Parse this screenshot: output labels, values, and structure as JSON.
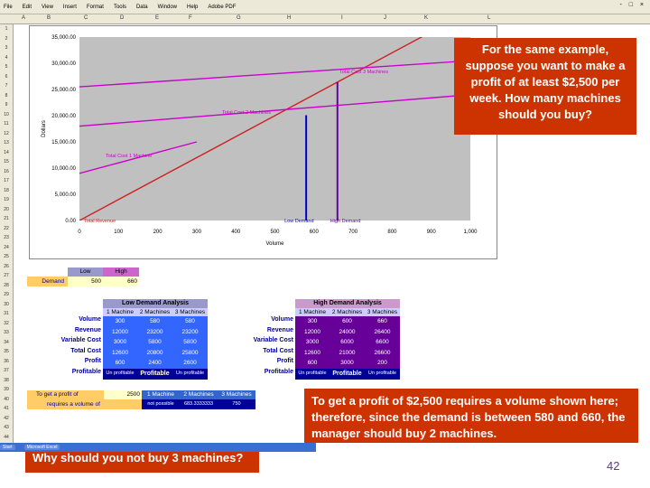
{
  "menubar": {
    "items": [
      "File",
      "Edit",
      "View",
      "Insert",
      "Format",
      "Tools",
      "Data",
      "Window",
      "Help",
      "Adobe PDF"
    ],
    "window_controls": "- □ ×"
  },
  "columns": [
    "A",
    "B",
    "C",
    "D",
    "E",
    "F",
    "G",
    "H",
    "I",
    "J",
    "K",
    "L"
  ],
  "rows": [
    "1",
    "2",
    "3",
    "4",
    "5",
    "6",
    "7",
    "8",
    "9",
    "10",
    "11",
    "12",
    "13",
    "14",
    "15",
    "16",
    "17",
    "18",
    "19",
    "20",
    "21",
    "22",
    "23",
    "24",
    "25",
    "26",
    "27",
    "28",
    "29",
    "30",
    "31",
    "32",
    "33",
    "34",
    "35",
    "36",
    "37",
    "38",
    "39",
    "40",
    "41",
    "42",
    "43",
    "44"
  ],
  "chart_data": {
    "type": "line",
    "xlabel": "Volume",
    "ylabel": "Dollars",
    "x_ticks": [
      "0",
      "100",
      "200",
      "300",
      "400",
      "500",
      "600",
      "700",
      "800",
      "900",
      "1,000"
    ],
    "y_ticks": [
      "0.00",
      "5,000.00",
      "10,000.00",
      "15,000.00",
      "20,000.00",
      "25,000.00",
      "30,000.00",
      "35,000.00"
    ],
    "xlim": [
      0,
      1000
    ],
    "ylim": [
      0,
      35000
    ],
    "series": [
      {
        "name": "Total Revenue",
        "color": "#cc2222",
        "points": [
          [
            0,
            0
          ],
          [
            1000,
            40000
          ]
        ]
      },
      {
        "name": "Total Cost 1 Machine",
        "color": "#cc00cc",
        "points": [
          [
            0,
            9000
          ],
          [
            300,
            15000
          ]
        ]
      },
      {
        "name": "Total Cost 2 Machines",
        "color": "#cc00cc",
        "points": [
          [
            0,
            18000
          ],
          [
            1000,
            24000
          ]
        ]
      },
      {
        "name": "Total Cost 3 Machines",
        "color": "#cc00cc",
        "points": [
          [
            0,
            25500
          ],
          [
            1000,
            30500
          ]
        ]
      }
    ],
    "markers": [
      {
        "name": "Low Demand",
        "x": 580,
        "y": 23200,
        "color": "#0000cc"
      },
      {
        "name": "High Demand",
        "x": 660,
        "y": 26400,
        "color": "#660099"
      }
    ]
  },
  "demand": {
    "label": "Demand",
    "low_header": "Low",
    "high_header": "High",
    "low": "500",
    "high": "660"
  },
  "row_labels": [
    "Volume",
    "Revenue",
    "Variable Cost",
    "Total Cost",
    "Profit",
    "Profitable"
  ],
  "machine_headers": [
    "1 Machine",
    "2 Machines",
    "3 Machines"
  ],
  "low_analysis": {
    "title": "Low Demand Analysis",
    "rows": [
      [
        "300",
        "580",
        "580"
      ],
      [
        "12000",
        "23200",
        "23200"
      ],
      [
        "3000",
        "5800",
        "5800"
      ],
      [
        "12600",
        "20800",
        "25800"
      ],
      [
        "600",
        "2400",
        "2600"
      ],
      [
        "Un profitable",
        "Profitable",
        "Un profitable"
      ]
    ]
  },
  "high_analysis": {
    "title": "High Demand Analysis",
    "rows": [
      [
        "300",
        "600",
        "660"
      ],
      [
        "12000",
        "24000",
        "26400"
      ],
      [
        "3000",
        "6000",
        "6600"
      ],
      [
        "12600",
        "21000",
        "26600"
      ],
      [
        "600",
        "3000",
        "200"
      ],
      [
        "Un profitable",
        "Profitable",
        "Un profitable"
      ]
    ]
  },
  "target": {
    "label1": "To get a profit of",
    "label2": "requires a volume of",
    "profit_value": "2500",
    "headers": [
      "1 Machine",
      "2 Machines",
      "3 Machines"
    ],
    "values": [
      "not possible",
      "683.3333333",
      "750"
    ]
  },
  "notes": {
    "top": "For the same example, suppose you want to make a profit of at least $2,500 per week. How many machines should you buy?",
    "bottom_right": "To get a profit of $2,500 requires a volume shown here; therefore, since the demand is between 580 and 660, the manager should buy 2 machines.",
    "bottom_left": "Why should you not buy 3 machines?"
  },
  "taskbar": [
    "Start",
    "Microsoft Excel"
  ],
  "slide_number": "42"
}
